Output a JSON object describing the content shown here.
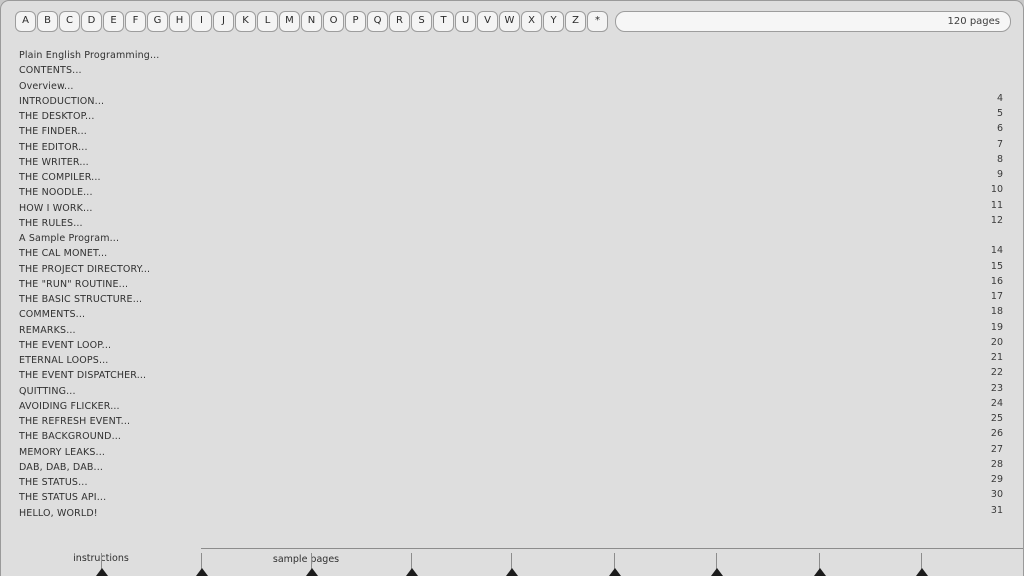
{
  "window": {
    "title": "Plain English Programming"
  },
  "toolbar": {
    "alphabet_buttons": [
      "A",
      "B",
      "C",
      "D",
      "E",
      "F",
      "G",
      "H",
      "I",
      "J",
      "K",
      "L",
      "M",
      "N",
      "O",
      "P",
      "Q",
      "R",
      "S",
      "T",
      "U",
      "V",
      "W",
      "X",
      "Y",
      "Z",
      "*"
    ],
    "search": {
      "value": "",
      "placeholder": ""
    },
    "page_count": "120 pages"
  },
  "contents": [
    {
      "title": "Plain English Programming...",
      "page": ""
    },
    {
      "title": "CONTENTS...",
      "page": ""
    },
    {
      "title": "Overview...",
      "page": ""
    },
    {
      "title": "INTRODUCTION...",
      "page": "4"
    },
    {
      "title": "THE DESKTOP...",
      "page": "5"
    },
    {
      "title": "THE FINDER...",
      "page": "6"
    },
    {
      "title": "THE EDITOR...",
      "page": "7"
    },
    {
      "title": "THE WRITER...",
      "page": "8"
    },
    {
      "title": "THE COMPILER...",
      "page": "9"
    },
    {
      "title": "THE NOODLE...",
      "page": "10"
    },
    {
      "title": "HOW I WORK...",
      "page": "11"
    },
    {
      "title": "THE RULES...",
      "page": "12"
    },
    {
      "title": "A Sample Program...",
      "page": ""
    },
    {
      "title": "THE CAL MONET...",
      "page": "14"
    },
    {
      "title": "THE PROJECT DIRECTORY...",
      "page": "15"
    },
    {
      "title": "THE \"RUN\" ROUTINE...",
      "page": "16"
    },
    {
      "title": "THE BASIC STRUCTURE...",
      "page": "17"
    },
    {
      "title": "COMMENTS...",
      "page": "18"
    },
    {
      "title": "REMARKS...",
      "page": "19"
    },
    {
      "title": "THE EVENT LOOP...",
      "page": "20"
    },
    {
      "title": "ETERNAL LOOPS...",
      "page": "21"
    },
    {
      "title": "THE EVENT DISPATCHER...",
      "page": "22"
    },
    {
      "title": "QUITTING...",
      "page": "23"
    },
    {
      "title": "AVOIDING FLICKER...",
      "page": "24"
    },
    {
      "title": "THE REFRESH EVENT...",
      "page": "25"
    },
    {
      "title": "THE BACKGROUND...",
      "page": "26"
    },
    {
      "title": "MEMORY LEAKS...",
      "page": "27"
    },
    {
      "title": "DAB, DAB, DAB...",
      "page": "28"
    },
    {
      "title": "THE STATUS...",
      "page": "29"
    },
    {
      "title": "THE STATUS API...",
      "page": "30"
    },
    {
      "title": "HELLO, WORLD!",
      "page": "31"
    }
  ],
  "tabs": [
    {
      "label": "instructions",
      "active": true
    },
    {
      "label": "sample pages",
      "active": false
    },
    {
      "label": "",
      "active": false
    },
    {
      "label": "",
      "active": false
    },
    {
      "label": "",
      "active": false
    },
    {
      "label": "",
      "active": false
    },
    {
      "label": "",
      "active": false
    }
  ],
  "colors": {
    "background": "#dedede",
    "border": "#9a9a9a",
    "text": "#313131",
    "button_face": "#f4f4f4"
  }
}
